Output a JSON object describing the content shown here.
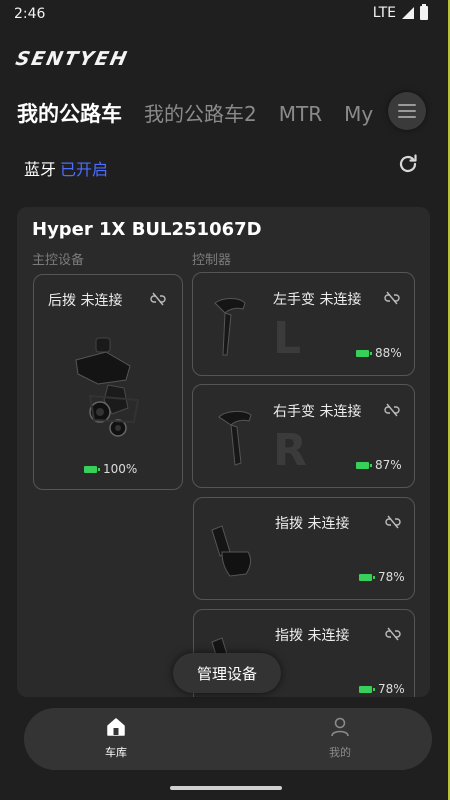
{
  "status_bar": {
    "time": "2:46",
    "network": "LTE"
  },
  "brand": {
    "logo_text": "SENTYEH"
  },
  "tabs": [
    {
      "label": "我的公路车",
      "active": true
    },
    {
      "label": "我的公路车2",
      "active": false
    },
    {
      "label": "MTR",
      "active": false
    },
    {
      "label": "My",
      "active": false
    }
  ],
  "bluetooth": {
    "label": "蓝牙",
    "status": "已开启"
  },
  "bike": {
    "name": "Hyper 1X BUL251067D",
    "main_label": "主控设备",
    "controller_label": "控制器",
    "main_device": {
      "name": "后拨 未连接",
      "battery": "100%"
    },
    "controllers": [
      {
        "name": "左手变 未连接",
        "battery": "88%",
        "letter": "L"
      },
      {
        "name": "右手变 未连接",
        "battery": "87%",
        "letter": "R"
      },
      {
        "name": "指拨 未连接",
        "battery": "78%"
      },
      {
        "name": "指拨 未连接",
        "battery": "78%"
      }
    ]
  },
  "manage_button": "管理设备",
  "nav": [
    {
      "label": "车库",
      "active": true
    },
    {
      "label": "我的",
      "active": false
    }
  ],
  "colors": {
    "accent_blue": "#4c6dff",
    "battery_green": "#37d05b",
    "frame_green": "#b9c43a"
  }
}
